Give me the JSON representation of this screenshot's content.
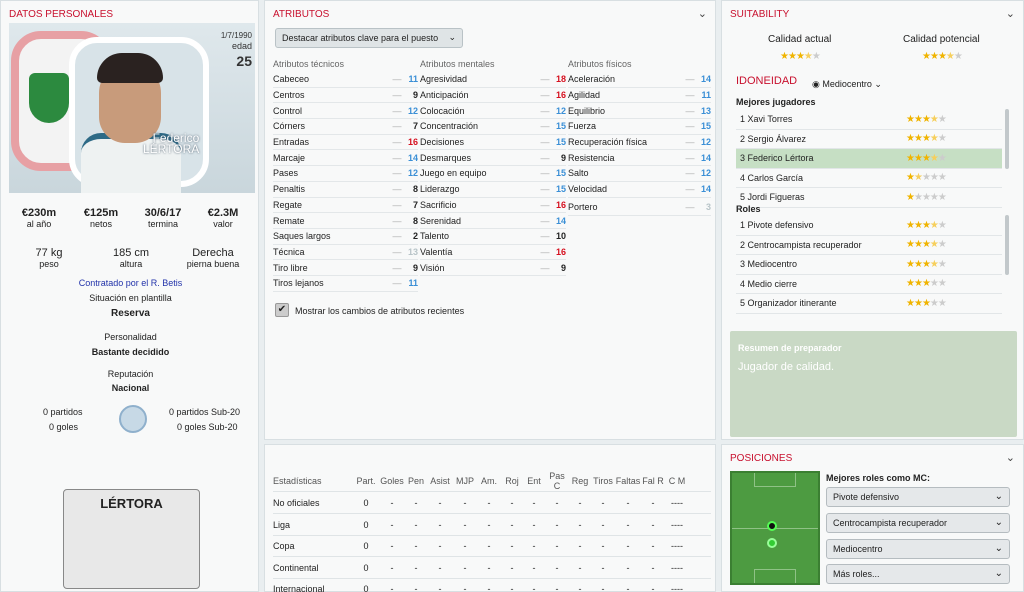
{
  "left": {
    "title": "DATOS PERSONALES",
    "dob": "1/7/1990",
    "age_label": "edad",
    "age": "25",
    "player_name_first": "Federico",
    "player_name_last": "LÉRTORA",
    "stats4": [
      {
        "v": "€230m",
        "l": "al año"
      },
      {
        "v": "€125m",
        "l": "netos"
      },
      {
        "v": "30/6/17",
        "l": "termina"
      },
      {
        "v": "€2.3M",
        "l": "valor"
      }
    ],
    "stats3": [
      {
        "v": "77 kg",
        "l": "peso"
      },
      {
        "v": "185 cm",
        "l": "altura"
      },
      {
        "v": "Derecha",
        "l": "pierna buena"
      }
    ],
    "contract": "Contratado por el R. Betis",
    "squad_label": "Situación en plantilla",
    "squad_value": "Reserva",
    "pers_label": "Personalidad",
    "pers_value": "Bastante decidido",
    "rep_label": "Reputación",
    "rep_value": "Nacional",
    "intl": {
      "partidos": "0 partidos",
      "goles": "0 goles",
      "partidos20": "0 partidos Sub-20",
      "goles20": "0 goles Sub-20"
    },
    "card_name": "LÉRTORA"
  },
  "attr": {
    "title": "ATRIBUTOS",
    "dropdown": "Destacar atributos clave para el puesto",
    "tech_head": "Atributos técnicos",
    "ment_head": "Atributos mentales",
    "phys_head": "Atributos físicos",
    "tech": [
      [
        "Cabeceo",
        "11",
        "b"
      ],
      [
        "Centros",
        "9",
        "n"
      ],
      [
        "Control",
        "12",
        "b"
      ],
      [
        "Córners",
        "7",
        "n"
      ],
      [
        "Entradas",
        "16",
        "r"
      ],
      [
        "Marcaje",
        "14",
        "b"
      ],
      [
        "Pases",
        "12",
        "b"
      ],
      [
        "Penaltis",
        "8",
        "n"
      ],
      [
        "Regate",
        "7",
        "n"
      ],
      [
        "Remate",
        "8",
        "n"
      ],
      [
        "Saques largos",
        "2",
        "n"
      ],
      [
        "Técnica",
        "13",
        "g"
      ],
      [
        "Tiro libre",
        "9",
        "n"
      ],
      [
        "Tiros lejanos",
        "11",
        "b"
      ]
    ],
    "ment": [
      [
        "Agresividad",
        "18",
        "r"
      ],
      [
        "Anticipación",
        "16",
        "r"
      ],
      [
        "Colocación",
        "12",
        "b"
      ],
      [
        "Concentración",
        "15",
        "b"
      ],
      [
        "Decisiones",
        "15",
        "b"
      ],
      [
        "Desmarques",
        "9",
        "n"
      ],
      [
        "Juego en equipo",
        "15",
        "b"
      ],
      [
        "Liderazgo",
        "15",
        "b"
      ],
      [
        "Sacrificio",
        "16",
        "r"
      ],
      [
        "Serenidad",
        "14",
        "b"
      ],
      [
        "Talento",
        "10",
        "n"
      ],
      [
        "Valentía",
        "16",
        "r"
      ],
      [
        "Visión",
        "9",
        "n"
      ]
    ],
    "phys": [
      [
        "Aceleración",
        "14",
        "b"
      ],
      [
        "Agilidad",
        "11",
        "b"
      ],
      [
        "Equilibrio",
        "13",
        "b"
      ],
      [
        "Fuerza",
        "15",
        "b"
      ],
      [
        "Recuperación física",
        "12",
        "b"
      ],
      [
        "Resistencia",
        "14",
        "b"
      ],
      [
        "Salto",
        "12",
        "b"
      ],
      [
        "Velocidad",
        "14",
        "b"
      ]
    ],
    "gk": [
      [
        "Portero",
        "3",
        "g"
      ]
    ],
    "check_label": "Mostrar los cambios de atributos recientes"
  },
  "stats": {
    "headers": [
      "Estadísticas",
      "Part.",
      "Goles",
      "Pen",
      "Asist",
      "MJP",
      "Am.",
      "Roj",
      "Ent",
      "Pas C",
      "Reg",
      "Tiros",
      "Faltas",
      "Fal R",
      "C M"
    ],
    "rows": [
      [
        "No oficiales",
        "0",
        "-",
        "-",
        "-",
        "-",
        "-",
        "-",
        "-",
        "-",
        "-",
        "-",
        "-",
        "-",
        "----"
      ],
      [
        "Liga",
        "0",
        "-",
        "-",
        "-",
        "-",
        "-",
        "-",
        "-",
        "-",
        "-",
        "-",
        "-",
        "-",
        "----"
      ],
      [
        "Copa",
        "0",
        "-",
        "-",
        "-",
        "-",
        "-",
        "-",
        "-",
        "-",
        "-",
        "-",
        "-",
        "-",
        "----"
      ],
      [
        "Continental",
        "0",
        "-",
        "-",
        "-",
        "-",
        "-",
        "-",
        "-",
        "-",
        "-",
        "-",
        "-",
        "-",
        "----"
      ],
      [
        "Internacional",
        "0",
        "-",
        "-",
        "-",
        "-",
        "-",
        "-",
        "-",
        "-",
        "-",
        "-",
        "-",
        "-",
        "----"
      ]
    ]
  },
  "suit": {
    "title": "SUITABILITY",
    "cur_label": "Calidad actual",
    "pot_label": "Calidad potencial",
    "cur_stars": 3.5,
    "pot_stars": 3.5,
    "idon": "IDONEIDAD",
    "role_sel": "Mediocentro",
    "best_label": "Mejores jugadores",
    "best": [
      [
        "1",
        "Xavi Torres",
        3.5
      ],
      [
        "2",
        "Sergio Álvarez",
        3.5
      ],
      [
        "3",
        "Federico Lértora",
        3.5
      ],
      [
        "4",
        "Carlos García",
        1.5
      ],
      [
        "5",
        "Jordi Figueras",
        1
      ]
    ],
    "roles_label": "Roles",
    "roles": [
      [
        "1",
        "Pivote defensivo",
        3.5
      ],
      [
        "2",
        "Centrocampista recuperador",
        3.5
      ],
      [
        "3",
        "Mediocentro",
        3.5
      ],
      [
        "4",
        "Medio cierre",
        3
      ],
      [
        "5",
        "Organizador itinerante",
        3
      ]
    ],
    "coach_title": "Resumen de preparador",
    "coach_text": "Jugador de calidad."
  },
  "pos": {
    "title": "POSICIONES",
    "best_label": "Mejores roles como MC:",
    "drops": [
      "Pivote defensivo",
      "Centrocampista recuperador",
      "Mediocentro",
      "Más roles..."
    ]
  }
}
